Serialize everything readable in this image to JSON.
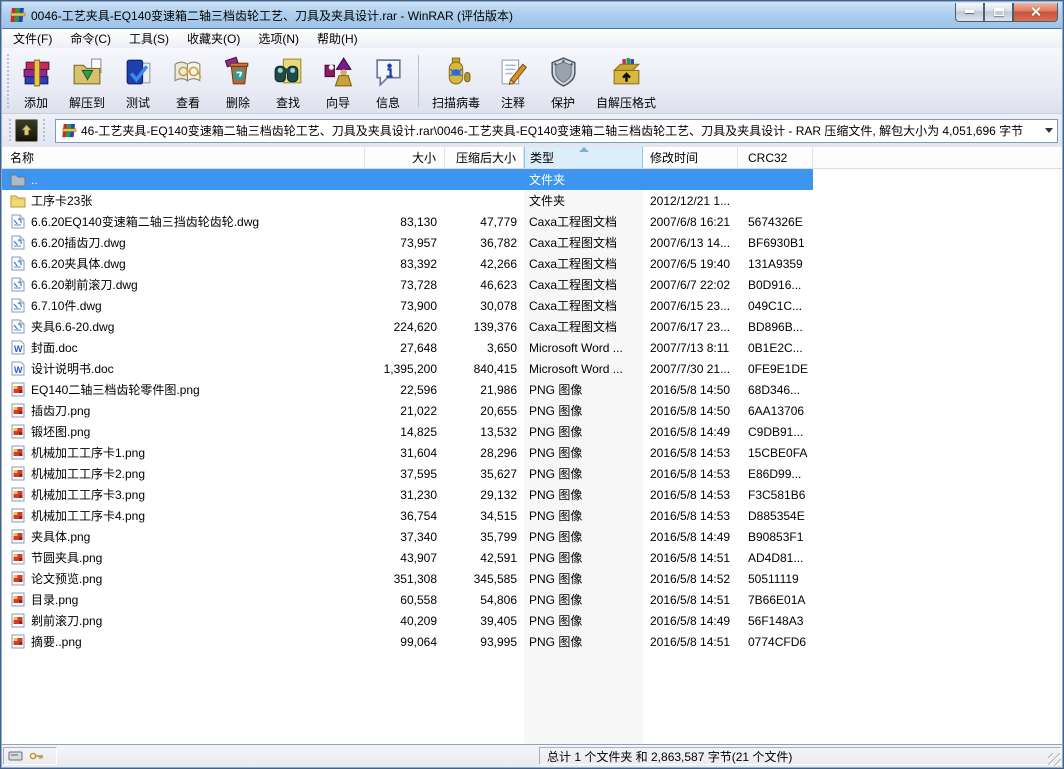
{
  "window": {
    "title": "0046-工艺夹具-EQ140变速箱二轴三档齿轮工艺、刀具及夹具设计.rar - WinRAR (评估版本)",
    "accent_titlebar": "#a8cbea",
    "selection_color": "#3d95f0"
  },
  "menu": {
    "items": [
      {
        "label": "文件(F)"
      },
      {
        "label": "命令(C)"
      },
      {
        "label": "工具(S)"
      },
      {
        "label": "收藏夹(O)"
      },
      {
        "label": "选项(N)"
      },
      {
        "label": "帮助(H)"
      }
    ]
  },
  "toolbar": {
    "buttons": [
      {
        "label": "添加",
        "icon": "add-archive-icon"
      },
      {
        "label": "解压到",
        "icon": "extract-to-icon"
      },
      {
        "label": "测试",
        "icon": "test-archive-icon"
      },
      {
        "label": "查看",
        "icon": "view-file-icon"
      },
      {
        "label": "删除",
        "icon": "delete-icon"
      },
      {
        "label": "查找",
        "icon": "find-icon"
      },
      {
        "label": "向导",
        "icon": "wizard-icon"
      },
      {
        "label": "信息",
        "icon": "info-icon"
      },
      {
        "label": "扫描病毒",
        "icon": "virus-scan-icon",
        "separator_before": true
      },
      {
        "label": "注释",
        "icon": "comment-icon"
      },
      {
        "label": "保护",
        "icon": "protect-icon"
      },
      {
        "label": "自解压格式",
        "icon": "sfx-icon"
      }
    ]
  },
  "addressbar": {
    "path": "46-工艺夹具-EQ140变速箱二轴三档齿轮工艺、刀具及夹具设计.rar\\0046-工艺夹具-EQ140变速箱二轴三档齿轮工艺、刀具及夹具设计 - RAR 压缩文件, 解包大小为 4,051,696 字节"
  },
  "columns": [
    {
      "label": "名称"
    },
    {
      "label": "大小"
    },
    {
      "label": "压缩后大小"
    },
    {
      "label": "类型",
      "sorted": "asc"
    },
    {
      "label": "修改时间"
    },
    {
      "label": "CRC32"
    }
  ],
  "files": [
    {
      "name": "..",
      "size": "",
      "packed": "",
      "type": "文件夹",
      "modified": "",
      "crc": "",
      "icon": "folder-up-icon",
      "selected": true
    },
    {
      "name": "工序卡23张",
      "size": "",
      "packed": "",
      "type": "文件夹",
      "modified": "2012/12/21 1...",
      "crc": "",
      "icon": "folder-icon"
    },
    {
      "name": "6.6.20EQ140变速箱二轴三挡齿轮齿轮.dwg",
      "size": "83,130",
      "packed": "47,779",
      "type": "Caxa工程图文档",
      "modified": "2007/6/8 16:21",
      "crc": "5674326E",
      "icon": "dwg-file-icon"
    },
    {
      "name": "6.6.20插齿刀.dwg",
      "size": "73,957",
      "packed": "36,782",
      "type": "Caxa工程图文档",
      "modified": "2007/6/13 14...",
      "crc": "BF6930B1",
      "icon": "dwg-file-icon"
    },
    {
      "name": "6.6.20夹具体.dwg",
      "size": "83,392",
      "packed": "42,266",
      "type": "Caxa工程图文档",
      "modified": "2007/6/5 19:40",
      "crc": "131A9359",
      "icon": "dwg-file-icon"
    },
    {
      "name": "6.6.20剃前滚刀.dwg",
      "size": "73,728",
      "packed": "46,623",
      "type": "Caxa工程图文档",
      "modified": "2007/6/7 22:02",
      "crc": "B0D916...",
      "icon": "dwg-file-icon"
    },
    {
      "name": "6.7.10件.dwg",
      "size": "73,900",
      "packed": "30,078",
      "type": "Caxa工程图文档",
      "modified": "2007/6/15 23...",
      "crc": "049C1C...",
      "icon": "dwg-file-icon"
    },
    {
      "name": "夹具6.6-20.dwg",
      "size": "224,620",
      "packed": "139,376",
      "type": "Caxa工程图文档",
      "modified": "2007/6/17 23...",
      "crc": "BD896B...",
      "icon": "dwg-file-icon"
    },
    {
      "name": "封面.doc",
      "size": "27,648",
      "packed": "3,650",
      "type": "Microsoft Word ...",
      "modified": "2007/7/13 8:11",
      "crc": "0B1E2C...",
      "icon": "doc-file-icon"
    },
    {
      "name": "设计说明书.doc",
      "size": "1,395,200",
      "packed": "840,415",
      "type": "Microsoft Word ...",
      "modified": "2007/7/30 21...",
      "crc": "0FE9E1DE",
      "icon": "doc-file-icon"
    },
    {
      "name": "EQ140二轴三档齿轮零件图.png",
      "size": "22,596",
      "packed": "21,986",
      "type": "PNG 图像",
      "modified": "2016/5/8 14:50",
      "crc": "68D346...",
      "icon": "png-file-icon"
    },
    {
      "name": "插齿刀.png",
      "size": "21,022",
      "packed": "20,655",
      "type": "PNG 图像",
      "modified": "2016/5/8 14:50",
      "crc": "6AA13706",
      "icon": "png-file-icon"
    },
    {
      "name": "锻坯图.png",
      "size": "14,825",
      "packed": "13,532",
      "type": "PNG 图像",
      "modified": "2016/5/8 14:49",
      "crc": "C9DB91...",
      "icon": "png-file-icon"
    },
    {
      "name": "机械加工工序卡1.png",
      "size": "31,604",
      "packed": "28,296",
      "type": "PNG 图像",
      "modified": "2016/5/8 14:53",
      "crc": "15CBE0FA",
      "icon": "png-file-icon"
    },
    {
      "name": "机械加工工序卡2.png",
      "size": "37,595",
      "packed": "35,627",
      "type": "PNG 图像",
      "modified": "2016/5/8 14:53",
      "crc": "E86D99...",
      "icon": "png-file-icon"
    },
    {
      "name": "机械加工工序卡3.png",
      "size": "31,230",
      "packed": "29,132",
      "type": "PNG 图像",
      "modified": "2016/5/8 14:53",
      "crc": "F3C581B6",
      "icon": "png-file-icon"
    },
    {
      "name": "机械加工工序卡4.png",
      "size": "36,754",
      "packed": "34,515",
      "type": "PNG 图像",
      "modified": "2016/5/8 14:53",
      "crc": "D885354E",
      "icon": "png-file-icon"
    },
    {
      "name": "夹具体.png",
      "size": "37,340",
      "packed": "35,799",
      "type": "PNG 图像",
      "modified": "2016/5/8 14:49",
      "crc": "B90853F1",
      "icon": "png-file-icon"
    },
    {
      "name": "节圆夹具.png",
      "size": "43,907",
      "packed": "42,591",
      "type": "PNG 图像",
      "modified": "2016/5/8 14:51",
      "crc": "AD4D81...",
      "icon": "png-file-icon"
    },
    {
      "name": "论文预览.png",
      "size": "351,308",
      "packed": "345,585",
      "type": "PNG 图像",
      "modified": "2016/5/8 14:52",
      "crc": "50511119",
      "icon": "png-file-icon"
    },
    {
      "name": "目录.png",
      "size": "60,558",
      "packed": "54,806",
      "type": "PNG 图像",
      "modified": "2016/5/8 14:51",
      "crc": "7B66E01A",
      "icon": "png-file-icon"
    },
    {
      "name": "剃前滚刀.png",
      "size": "40,209",
      "packed": "39,405",
      "type": "PNG 图像",
      "modified": "2016/5/8 14:49",
      "crc": "56F148A3",
      "icon": "png-file-icon"
    },
    {
      "name": "摘要..png",
      "size": "99,064",
      "packed": "93,995",
      "type": "PNG 图像",
      "modified": "2016/5/8 14:51",
      "crc": "0774CFD6",
      "icon": "png-file-icon"
    }
  ],
  "statusbar": {
    "total": "总计 1 个文件夹 和 2,863,587 字节(21 个文件)"
  }
}
